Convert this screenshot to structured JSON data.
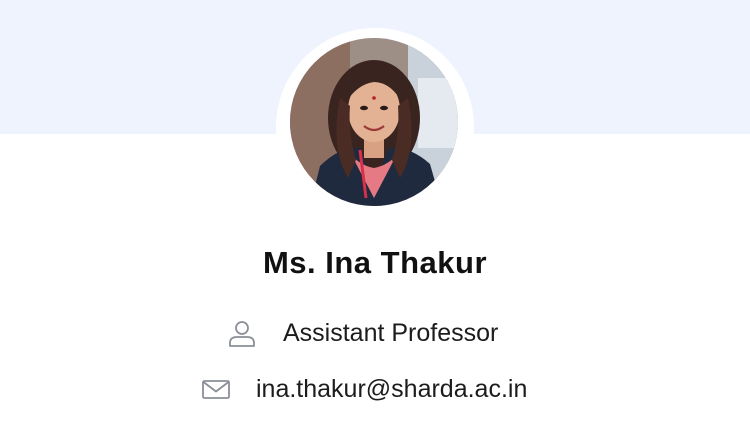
{
  "profile": {
    "name": "Ms. Ina Thakur",
    "designation": "Assistant Professor",
    "email": "ina.thakur@sharda.ac.in",
    "photo_alt": "Ms. Ina Thakur"
  },
  "icons": {
    "designation": "user-icon",
    "email": "mail-icon"
  },
  "colors": {
    "banner": "#eef3fd",
    "text": "#111111",
    "icon": "#8a8f96"
  }
}
